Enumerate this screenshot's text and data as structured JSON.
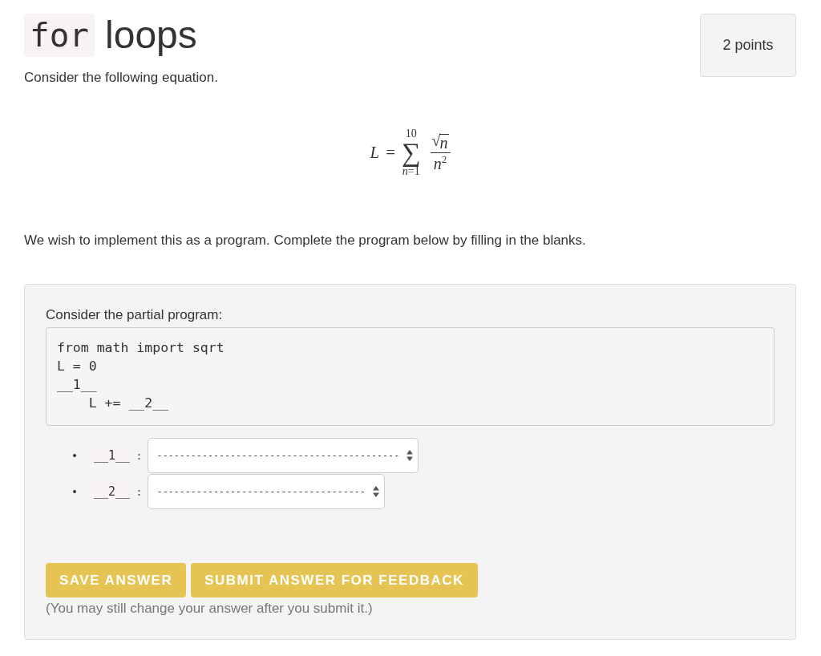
{
  "header": {
    "title_code": "for",
    "title_text": "loops",
    "points": "2 points"
  },
  "intro": "Consider the following equation.",
  "equation": {
    "lhs": "L",
    "relation": "=",
    "operator": "∑",
    "upper": "10",
    "lower": "*n*=1",
    "numerator": {
      "radical": "√",
      "radicand": "n"
    },
    "denominator": "*n*$^{2}$"
  },
  "instructions": "We wish to implement this as a program. Complete the program below by filling in the blanks.",
  "question": {
    "prompt": "Consider the partial program:",
    "code_lines": [
      "from math import sqrt",
      "L = 0",
      "__1__",
      "    L += __2__"
    ],
    "blanks": [
      {
        "label": "__1__",
        "separator": ":",
        "value": "-------------------------------------------"
      },
      {
        "label": "__2__",
        "separator": ":",
        "value": "-------------------------------------"
      }
    ],
    "buttons": [
      "SAVE ANSWER",
      "SUBMIT ANSWER FOR FEEDBACK"
    ],
    "note": "(You may still change your answer after you submit it.)"
  }
}
